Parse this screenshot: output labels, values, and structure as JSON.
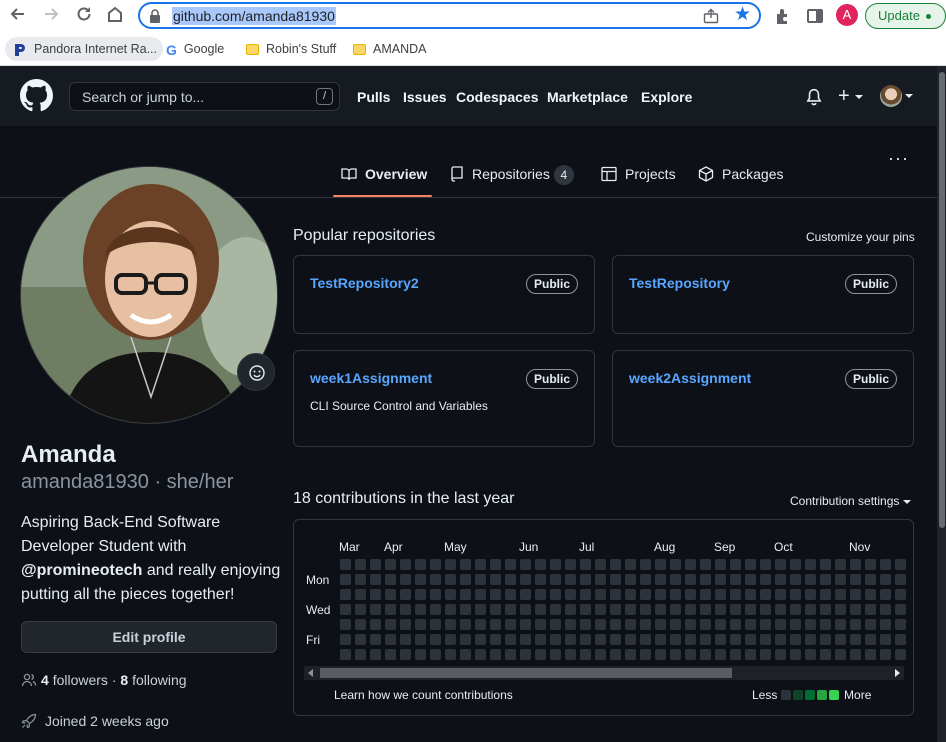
{
  "browser": {
    "url": "github.com/amanda81930",
    "profile_initial": "A",
    "update_label": "Update",
    "bookmarks": [
      {
        "label": "Pandora Internet Ra...",
        "icon": "pandora-icon"
      },
      {
        "label": "Google",
        "icon": "google-icon"
      },
      {
        "label": "Robin's Stuff",
        "icon": "folder-icon"
      },
      {
        "label": "AMANDA",
        "icon": "folder-icon"
      }
    ]
  },
  "header": {
    "search_placeholder": "Search or jump to...",
    "search_shortcut": "/",
    "nav": [
      "Pulls",
      "Issues",
      "Codespaces",
      "Marketplace",
      "Explore"
    ],
    "plus": "+"
  },
  "tabs": {
    "overview": "Overview",
    "repositories": "Repositories",
    "repositories_count": "4",
    "projects": "Projects",
    "packages": "Packages",
    "more": "···"
  },
  "profile": {
    "name": "Amanda",
    "login": "amanda81930 · she/her",
    "bio_pre": "Aspiring Back-End Software Developer Student with ",
    "bio_mention": "@promineotech",
    "bio_post": " and really enjoying putting all the pieces together!",
    "edit_label": "Edit profile",
    "followers_count": "4",
    "followers_label": "followers",
    "sep": "·",
    "following_count": "8",
    "following_label": "following",
    "joined": "Joined 2 weeks ago"
  },
  "popular": {
    "title": "Popular repositories",
    "customize": "Customize your pins",
    "repos": [
      {
        "name": "TestRepository2",
        "visibility": "Public",
        "description": ""
      },
      {
        "name": "TestRepository",
        "visibility": "Public",
        "description": ""
      },
      {
        "name": "week1Assignment",
        "visibility": "Public",
        "description": "CLI Source Control and Variables"
      },
      {
        "name": "week2Assignment",
        "visibility": "Public",
        "description": ""
      }
    ]
  },
  "contributions": {
    "title": "18 contributions in the last year",
    "settings": "Contribution settings",
    "months": [
      "Mar",
      "Apr",
      "May",
      "Jun",
      "Jul",
      "Aug",
      "Sep",
      "Oct",
      "Nov"
    ],
    "weekdays": [
      "Mon",
      "Wed",
      "Fri"
    ],
    "learn": "Learn how we count contributions",
    "less": "Less",
    "more": "More",
    "legend_colors": [
      "#2d333b",
      "#0e4429",
      "#006d32",
      "#26a641",
      "#39d353"
    ]
  }
}
